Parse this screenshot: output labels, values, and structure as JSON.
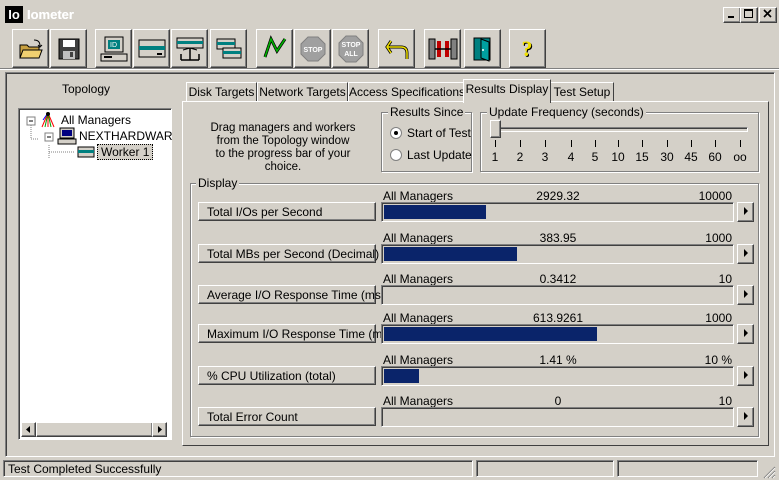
{
  "window": {
    "app_icon": "Io",
    "title": "Iometer"
  },
  "toolbar": {
    "icons": [
      "open-icon",
      "save-icon",
      "new-disk-worker-icon",
      "new-network-worker-icon",
      "duplicate-worker-icon",
      "copy-worker-icon",
      "start-icon",
      "stop-icon",
      "stop-all-icon",
      "reset-workers-icon",
      "disconnect-managers-icon",
      "exit-icon",
      "help-icon"
    ],
    "stop_label": "STOP",
    "stop_all_label_1": "STOP",
    "stop_all_label_2": "ALL",
    "help_label": "?"
  },
  "topology": {
    "title": "Topology",
    "root": "All Managers",
    "manager": "NEXTHARDWAR",
    "worker": "Worker 1"
  },
  "tabs": [
    "Disk Targets",
    "Network Targets",
    "Access Specifications",
    "Results Display",
    "Test Setup"
  ],
  "active_tab": "Results Display",
  "instructions": [
    "Drag managers and workers",
    "from the Topology window",
    "to the progress bar of your choice."
  ],
  "results_since": {
    "title": "Results Since",
    "options": [
      "Start of Test",
      "Last Update"
    ],
    "selected": "Start of Test"
  },
  "update_frequency": {
    "title": "Update Frequency (seconds)",
    "ticks": [
      "1",
      "2",
      "3",
      "4",
      "5",
      "10",
      "15",
      "30",
      "45",
      "60",
      "oo"
    ],
    "selected_index": 0
  },
  "display": {
    "title": "Display",
    "rows": [
      {
        "label": "Total I/Os per Second",
        "source": "All Managers",
        "value": "2929.32",
        "max": "10000",
        "fill": 0.2929
      },
      {
        "label": "Total MBs per Second (Decimal)",
        "source": "All Managers",
        "value": "383.95",
        "max": "1000",
        "fill": 0.384
      },
      {
        "label": "Average I/O Response Time (ms)",
        "source": "All Managers",
        "value": "0.3412",
        "max": "10",
        "fill": 0.0
      },
      {
        "label": "Maximum I/O Response Time (ms)",
        "source": "All Managers",
        "value": "613.9261",
        "max": "1000",
        "fill": 0.614
      },
      {
        "label": "% CPU Utilization (total)",
        "source": "All Managers",
        "value": "1.41 %",
        "max": "10 %",
        "fill": 0.1
      },
      {
        "label": "Total Error Count",
        "source": "All Managers",
        "value": "0",
        "max": "10",
        "fill": 0.0
      }
    ]
  },
  "statusbar": {
    "text": "Test Completed Successfully"
  },
  "colors": {
    "bar": "#0a246a",
    "face": "#d4d0c8"
  }
}
